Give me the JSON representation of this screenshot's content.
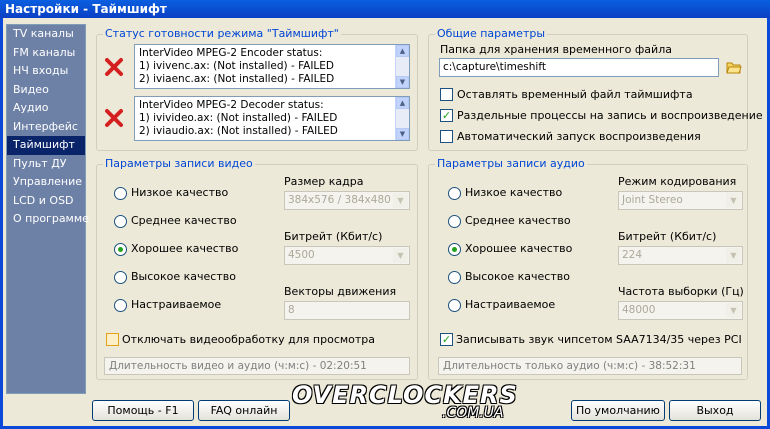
{
  "window": {
    "title": "Настройки - Таймшифт"
  },
  "sidebar": {
    "items": [
      {
        "label": "TV каналы",
        "selected": false
      },
      {
        "label": "FM каналы",
        "selected": false
      },
      {
        "label": "НЧ входы",
        "selected": false
      },
      {
        "label": "Видео",
        "selected": false
      },
      {
        "label": "Аудио",
        "selected": false
      },
      {
        "label": "Интерфейс",
        "selected": false
      },
      {
        "label": "Таймшифт",
        "selected": true
      },
      {
        "label": "Пульт ДУ",
        "selected": false
      },
      {
        "label": "Управление",
        "selected": false
      },
      {
        "label": "LCD и OSD",
        "selected": false
      },
      {
        "label": "О программе",
        "selected": false
      }
    ]
  },
  "status_group": {
    "title": "Статус готовности режима \"Таймшифт\"",
    "encoder": {
      "line1": "InterVideo MPEG-2 Encoder status:",
      "line2": "1) ivivenc.ax:  (Not installed) - FAILED",
      "line3": "2) iviaenc.ax:  (Not installed) - FAILED"
    },
    "decoder": {
      "line1": "InterVideo MPEG-2 Decoder status:",
      "line2": "1) ivivideo.ax:  (Not installed) - FAILED",
      "line3": "2) iviaudio.ax:  (Not installed) - FAILED"
    }
  },
  "general_group": {
    "title": "Общие параметры",
    "folder_label": "Папка для хранения временного файла",
    "folder_value": "c:\\capture\\timeshift",
    "keep_temp": {
      "label": "Оставлять временный файл таймшифта",
      "checked": false
    },
    "separate_processes": {
      "label": "Раздельные процессы на запись и воспроизведение",
      "checked": true
    },
    "auto_playback": {
      "label": "Автоматический запуск воспроизведения",
      "checked": false
    }
  },
  "video_group": {
    "title": "Параметры записи видео",
    "quality_options": [
      {
        "label": "Низкое качество",
        "selected": false
      },
      {
        "label": "Среднее качество",
        "selected": false
      },
      {
        "label": "Хорошее качество",
        "selected": true
      },
      {
        "label": "Высокое качество",
        "selected": false
      },
      {
        "label": "Настраиваемое",
        "selected": false
      }
    ],
    "frame_size_label": "Размер кадра",
    "frame_size_value": "384x576 / 384x480",
    "bitrate_label": "Битрейт (Кбит/с)",
    "bitrate_value": "4500",
    "motion_label": "Векторы движения",
    "motion_value": "8",
    "disable_processing": {
      "label": "Отключать видеообработку для просмотра",
      "checked": false
    },
    "duration": "Длительность видео и аудио (ч:м:с) - 02:20:51"
  },
  "audio_group": {
    "title": "Параметры записи аудио",
    "quality_options": [
      {
        "label": "Низкое качество",
        "selected": false
      },
      {
        "label": "Среднее качество",
        "selected": false
      },
      {
        "label": "Хорошее качество",
        "selected": true
      },
      {
        "label": "Высокое качество",
        "selected": false
      },
      {
        "label": "Настраиваемое",
        "selected": false
      }
    ],
    "mode_label": "Режим кодирования",
    "mode_value": "Joint Stereo",
    "bitrate_label": "Битрейт (Кбит/с)",
    "bitrate_value": "224",
    "samplerate_label": "Частота выборки (Гц)",
    "samplerate_value": "48000",
    "saa_chipset": {
      "label": "Записывать звук чипсетом SAA7134/35 через PCI",
      "checked": true
    },
    "duration": "Длительность только аудио (ч:м:с) - 38:52:31"
  },
  "buttons": {
    "help": "Помощь - F1",
    "faq": "FAQ онлайн",
    "defaults": "По умолчанию",
    "exit": "Выход"
  },
  "watermark": {
    "main": "OVERCLOCKERS",
    "sub": ".COM.UA"
  },
  "colors": {
    "title_bar": "#0A5FE0",
    "sidebar": "#6D80A6",
    "selected_item": "#0A246A",
    "group_title": "#0046D5",
    "fail_icon": "#D42020"
  }
}
